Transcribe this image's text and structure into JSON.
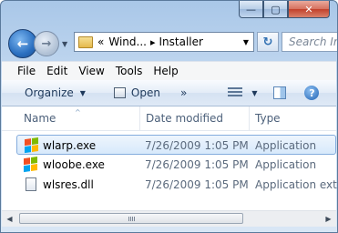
{
  "window": {
    "minimize_glyph": "—",
    "maximize_glyph": "▢",
    "close_glyph": "✕"
  },
  "navigation": {
    "back_glyph": "←",
    "forward_glyph": "→",
    "dropdown_glyph": "▼"
  },
  "address": {
    "overflow": "«",
    "crumbs": [
      "Wind...",
      "Installer"
    ],
    "separator": "▸",
    "dropdown_glyph": "▼"
  },
  "refresh_glyph": "↻",
  "search": {
    "placeholder": "Search In"
  },
  "menu": {
    "items": [
      "File",
      "Edit",
      "View",
      "Tools",
      "Help"
    ]
  },
  "toolbar": {
    "organize_label": "Organize",
    "open_label": "Open",
    "more_glyph": "»",
    "arrow_glyph": "▼",
    "help_glyph": "?"
  },
  "columns": {
    "name": "Name",
    "date": "Date modified",
    "type": "Type"
  },
  "files": [
    {
      "name": "wlarp.exe",
      "date": "7/26/2009 1:05 PM",
      "type": "Application",
      "icon": "windows-flag-icon",
      "selected": true
    },
    {
      "name": "wloobe.exe",
      "date": "7/26/2009 1:05 PM",
      "type": "Application",
      "icon": "windows-flag-icon",
      "selected": false
    },
    {
      "name": "wlsres.dll",
      "date": "7/26/2009 1:05 PM",
      "type": "Application exte",
      "icon": "dll-file-icon",
      "selected": false
    }
  ],
  "scrollbar": {
    "left_glyph": "◀",
    "right_glyph": "▶"
  },
  "colors": {
    "flag_red": "#f25022",
    "flag_green": "#7fba00",
    "flag_blue": "#00a4ef",
    "flag_yellow": "#ffb900",
    "selection": "#d7e9fb"
  }
}
